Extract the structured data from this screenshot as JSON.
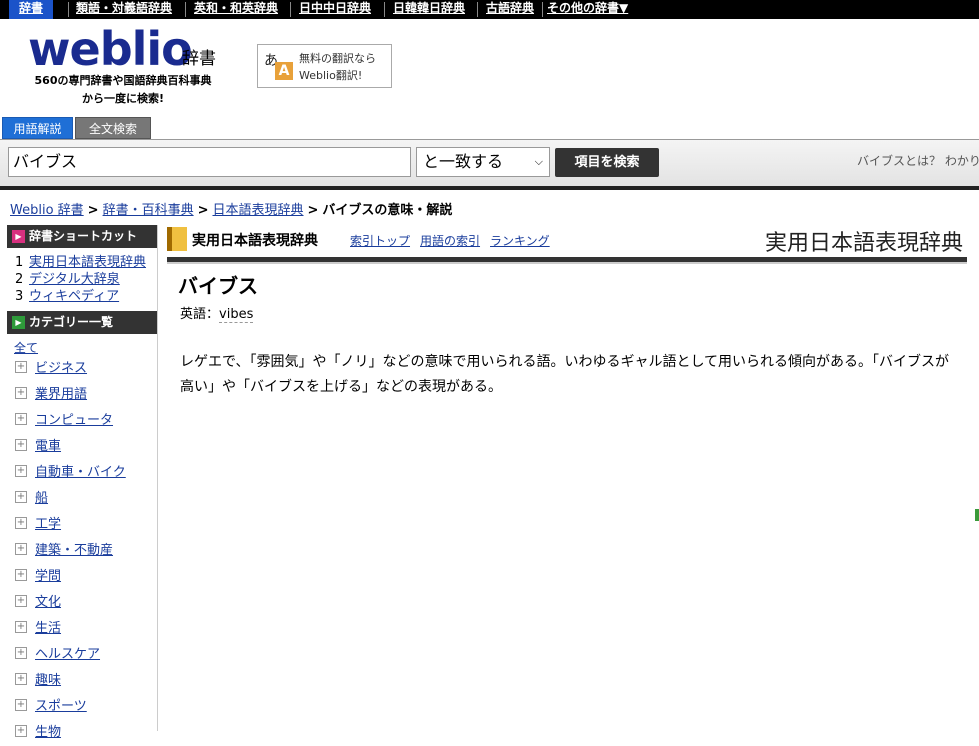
{
  "topnav": {
    "items": [
      "辞書",
      "類語・対義語辞典",
      "英和・和英辞典",
      "日中中日辞典",
      "日韓韓日辞典",
      "古語辞典",
      "その他の辞書▼"
    ]
  },
  "header": {
    "logo": "weblio",
    "logo_suffix": "辞書",
    "tagline_line1": "560の専門辞書や国語辞典百科事典",
    "tagline_line2": "から一度に検索!",
    "translate_promo_line1": "無料の翻訳なら",
    "translate_promo_line2": "Weblio翻訳!"
  },
  "tabs": {
    "active": "用語解説",
    "inactive": "全文検索"
  },
  "search": {
    "query": "バイブス",
    "match_mode": "と一致する",
    "button_label": "項目を検索",
    "hint": "バイブスとは？ わかり"
  },
  "breadcrumb": {
    "items": [
      "Weblio 辞書",
      "辞書・百科事典",
      "日本語表現辞典"
    ],
    "current": "バイブスの意味・解説"
  },
  "sidebar": {
    "shortcut_title": "辞書ショートカット",
    "shortcuts": [
      {
        "num": "1",
        "label": "実用日本語表現辞典"
      },
      {
        "num": "2",
        "label": "デジタル大辞泉"
      },
      {
        "num": "3",
        "label": "ウィキペディア"
      }
    ],
    "category_title": "カテゴリー一覧",
    "all_label": "全て",
    "categories": [
      "ビジネス",
      "業界用語",
      "コンピュータ",
      "電車",
      "自動車・バイク",
      "船",
      "工学",
      "建築・不動産",
      "学問",
      "文化",
      "生活",
      "ヘルスケア",
      "趣味",
      "スポーツ",
      "生物"
    ]
  },
  "dictionary": {
    "name": "実用日本語表現辞典",
    "links": [
      "索引トップ",
      "用語の索引",
      "ランキング"
    ],
    "logo_text": "実用日本語表現辞典"
  },
  "entry": {
    "title": "バイブス",
    "english_label": "英語：",
    "english_value": "vibes",
    "definition": "レゲエで、「雰囲気」や「ノリ」などの意味で用いられる語。いわゆるギャル語として用いられる傾向がある。「バイブスが高い」や「バイブスを上げる」などの表現がある。"
  },
  "colors": {
    "nav_bg": "#000000",
    "nav_active": "#1b53c9",
    "logo": "#1a2b8f",
    "link": "#1a3d9c",
    "tab_active": "#1f6fd6"
  }
}
